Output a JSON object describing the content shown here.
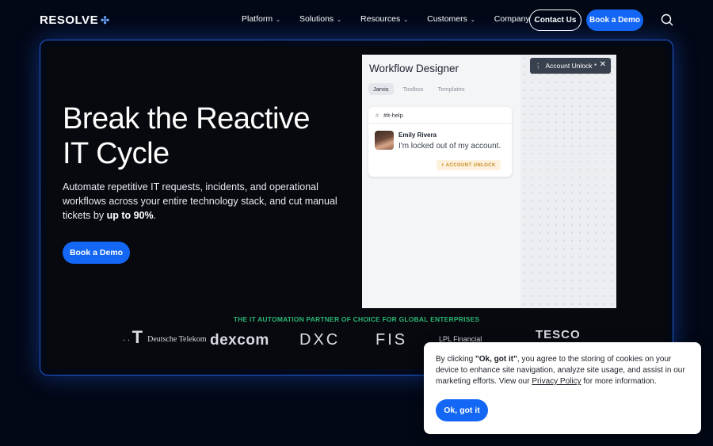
{
  "nav": {
    "logo": "RESOLVE",
    "menu": [
      {
        "label": "Platform"
      },
      {
        "label": "Solutions"
      },
      {
        "label": "Resources"
      },
      {
        "label": "Customers"
      },
      {
        "label": "Company"
      }
    ],
    "contact_label": "Contact Us",
    "demo_label": "Book a Demo"
  },
  "hero": {
    "title_line1": "Break the Reactive",
    "title_line2": "IT Cycle",
    "subtitle": "Automate repetitive IT requests, incidents, and operational workflows across your entire technology stack, and cut manual tickets by ",
    "subtitle_bold": "up to 90%",
    "subtitle_end": ".",
    "cta_label": "Book a Demo"
  },
  "workflow": {
    "title": "Workflow Designer",
    "tabs": [
      "Jarvis",
      "Toolbox",
      "Templates"
    ],
    "channel": "#it-help",
    "message_name": "Emily Rivera",
    "message_text": "I'm locked out of my account.",
    "badge": "+ ACCOUNT UNLOCK",
    "chip_label": "Account Unlock *"
  },
  "partners": {
    "heading": "THE IT AUTOMATION PARTNER OF CHOICE FOR GLOBAL ENTERPRISES",
    "logos": [
      "Deutsche Telekom",
      "dexcom",
      "DXC",
      "FIS",
      "LPL Financial",
      "TESCO"
    ]
  },
  "cookie": {
    "prefix": "By clicking ",
    "bold": "\"Ok, got it\"",
    "middle": ", you agree to the storing of cookies on your device to enhance site navigation, analyze site usage, and assist in our marketing efforts. View our ",
    "link": "Privacy Policy",
    "suffix": " for more information.",
    "button": "Ok, got it"
  },
  "colors": {
    "accent": "#1467f5",
    "partner_green": "#2bb673",
    "background": "#030816"
  }
}
